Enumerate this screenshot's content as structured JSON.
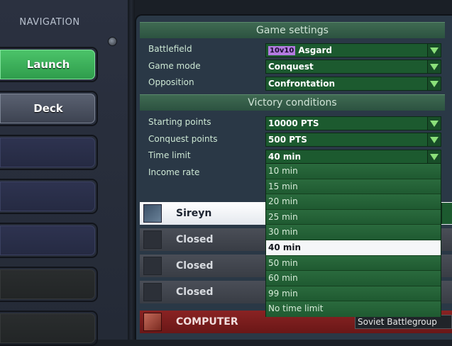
{
  "navigation": {
    "title": "NAVIGATION",
    "buttons": [
      {
        "label": "Launch",
        "style": "green"
      },
      {
        "label": "Deck",
        "style": "grey"
      },
      {
        "label": "",
        "style": "navy"
      },
      {
        "label": "",
        "style": "navy"
      },
      {
        "label": "",
        "style": "navy"
      },
      {
        "label": "",
        "style": "dark"
      },
      {
        "label": "",
        "style": "dark"
      }
    ]
  },
  "game_settings": {
    "title": "Game settings",
    "battlefield_label": "Battlefield",
    "battlefield_badge": "10v10",
    "battlefield_value": "Asgard",
    "game_mode_label": "Game mode",
    "game_mode_value": "Conquest",
    "opposition_label": "Opposition",
    "opposition_value": "Confrontation"
  },
  "victory_conditions": {
    "title": "Victory conditions",
    "starting_points_label": "Starting points",
    "starting_points_value": "10000 PTS",
    "conquest_points_label": "Conquest points",
    "conquest_points_value": "500 PTS",
    "time_limit_label": "Time limit",
    "time_limit_value": "40 min",
    "income_rate_label": "Income rate"
  },
  "time_limit_options": [
    "10 min",
    "15 min",
    "20 min",
    "25 min",
    "30 min",
    "40 min",
    "50 min",
    "60 min",
    "99 min",
    "No time limit"
  ],
  "time_limit_selected_index": 5,
  "players": [
    {
      "name": "Sireyn",
      "style": "white"
    },
    {
      "name": "Closed",
      "style": "closed"
    },
    {
      "name": "Closed",
      "style": "closed"
    },
    {
      "name": "Closed",
      "style": "closed"
    },
    {
      "name": "COMPUTER",
      "style": "red",
      "deck": "Soviet Battlegroup"
    }
  ],
  "colors": {
    "launch_green": "#3fb55c",
    "dropdown_green": "#1f5a31",
    "computer_red": "#7a1d1d",
    "header_green": "#355e47"
  }
}
